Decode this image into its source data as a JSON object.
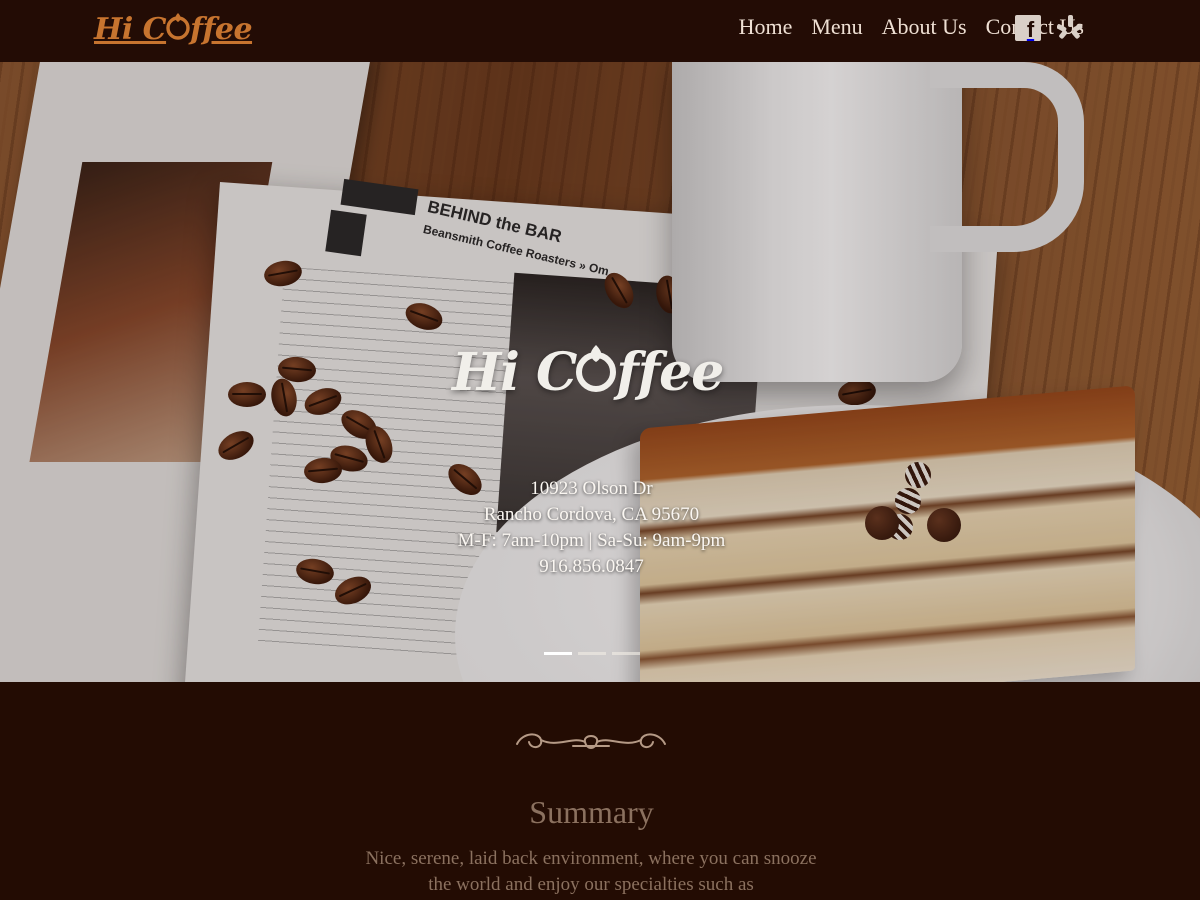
{
  "header": {
    "logo_text_before": "Hi C",
    "logo_text_after": "ffee",
    "nav": [
      {
        "label": "Home"
      },
      {
        "label": "Menu"
      },
      {
        "label": "About Us"
      },
      {
        "label": "Contact Us"
      }
    ],
    "social": [
      {
        "icon": "facebook-icon",
        "glyph": "f"
      },
      {
        "icon": "yelp-icon"
      }
    ]
  },
  "hero": {
    "logo_text_before": "Hi C",
    "logo_text_after": "ffee",
    "magazine": {
      "title": "BEHIND the BAR",
      "subtitle": "Beansmith Coffee Roasters » Om"
    },
    "address_line1": "10923 Olson Dr",
    "address_line2": "Rancho Cordova, CA 95670",
    "hours": "M-F: 7am-10pm | Sa-Su: 9am-9pm",
    "phone": "916.856.0847",
    "slides": [
      {
        "active": true
      },
      {
        "active": false
      },
      {
        "active": false
      }
    ]
  },
  "summary": {
    "title": "Summary",
    "text": "Nice, serene, laid back environment, where you can snooze the world and enjoy our specialties such as"
  },
  "colors": {
    "header_bg": "#230c05",
    "logo": "#c7742f",
    "nav_text": "#eedfd3",
    "section_bg": "#230c03",
    "summary_text": "#8b715f",
    "ornament": "#b59a86"
  }
}
